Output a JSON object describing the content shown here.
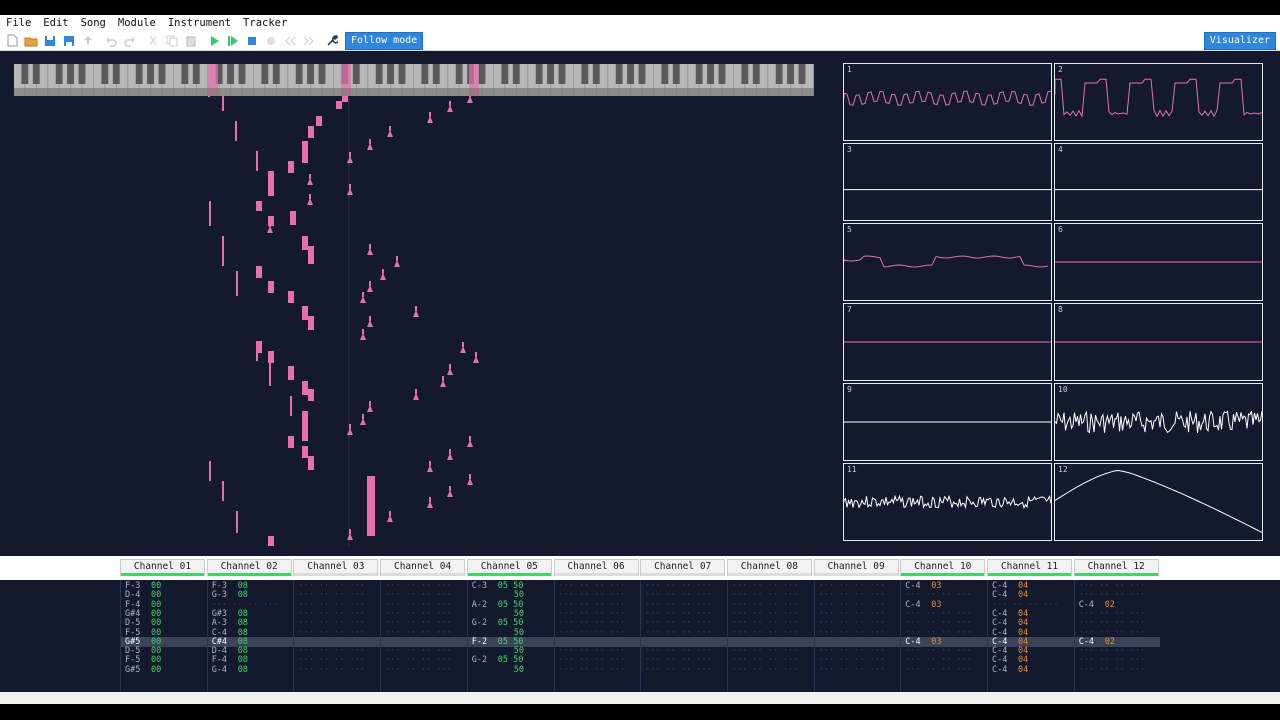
{
  "menu": [
    "File",
    "Edit",
    "Song",
    "Module",
    "Instrument",
    "Tracker"
  ],
  "toolbar": {
    "follow_label": "Follow mode",
    "visualizer_label": "Visualizer",
    "icons": [
      "new-file-icon",
      "open-folder-icon",
      "save-icon",
      "save-as-icon",
      "export-icon",
      "undo-icon",
      "redo-icon",
      "cut-icon",
      "copy-icon",
      "paste-icon",
      "play-icon",
      "play-pattern-icon",
      "stop-icon",
      "record-icon",
      "rewind-icon",
      "fast-forward-icon",
      "settings-wrench-icon"
    ]
  },
  "visualizer": {
    "channels": [
      "1",
      "2",
      "3",
      "4",
      "5",
      "6",
      "7",
      "8",
      "9",
      "10",
      "11",
      "12"
    ]
  },
  "channels": [
    {
      "name": "Channel 01",
      "active": true
    },
    {
      "name": "Channel 02",
      "active": true
    },
    {
      "name": "Channel 03",
      "active": false
    },
    {
      "name": "Channel 04",
      "active": false
    },
    {
      "name": "Channel 05",
      "active": true
    },
    {
      "name": "Channel 06",
      "active": false
    },
    {
      "name": "Channel 07",
      "active": false
    },
    {
      "name": "Channel 08",
      "active": false
    },
    {
      "name": "Channel 09",
      "active": false
    },
    {
      "name": "Channel 10",
      "active": true
    },
    {
      "name": "Channel 11",
      "active": true
    },
    {
      "name": "Channel 12",
      "active": true
    }
  ],
  "pattern": {
    "current_row": 6,
    "columns": {
      "0": [
        [
          "F-3",
          "00"
        ],
        [
          "D-4",
          "00"
        ],
        [
          "F-4",
          "00"
        ],
        [
          "G#4",
          "00"
        ],
        [
          "D-5",
          "00"
        ],
        [
          "F-5",
          "00"
        ],
        [
          "G#5",
          "00"
        ],
        [
          "D-5",
          "00"
        ],
        [
          "F-5",
          "00"
        ],
        [
          "G#5",
          "00"
        ]
      ],
      "1": [
        [
          "F-3",
          "08"
        ],
        [
          "G-3",
          "08"
        ],
        null,
        [
          "G#3",
          "08"
        ],
        [
          "A-3",
          "08"
        ],
        [
          "C-4",
          "08"
        ],
        [
          "C#4",
          "08"
        ],
        [
          "D-4",
          "08"
        ],
        [
          "F-4",
          "08"
        ],
        [
          "G-4",
          "08"
        ]
      ],
      "4": [
        [
          "C-3",
          "05 50"
        ],
        [
          "",
          "50"
        ],
        [
          "A-2",
          "05 50"
        ],
        [
          "",
          "50"
        ],
        [
          "G-2",
          "05 50"
        ],
        [
          "",
          "50"
        ],
        [
          "F-2",
          "05 50"
        ],
        [
          "",
          "50"
        ],
        [
          "G-2",
          "05 50"
        ],
        [
          "",
          "50"
        ]
      ],
      "9": [
        [
          "C-4",
          "03"
        ],
        null,
        [
          "C-4",
          "03"
        ],
        null,
        null,
        null,
        [
          "C-4",
          "03"
        ],
        null,
        null,
        null
      ],
      "10": [
        [
          "C-4",
          "04"
        ],
        [
          "C-4",
          "04"
        ],
        null,
        [
          "C-4",
          "04"
        ],
        [
          "C-4",
          "04"
        ],
        [
          "C-4",
          "04"
        ],
        [
          "C-4",
          "04"
        ],
        [
          "C-4",
          "04"
        ],
        [
          "C-4",
          "04"
        ],
        [
          "C-4",
          "04"
        ]
      ],
      "11": [
        null,
        null,
        [
          "C-4",
          "02"
        ],
        null,
        null,
        null,
        [
          "C-4",
          "02"
        ],
        null,
        null,
        null
      ]
    }
  },
  "colors": {
    "background": "#141a2e",
    "note": "#e76fad",
    "accent": "#2e86de",
    "active": "#3ed36b"
  }
}
